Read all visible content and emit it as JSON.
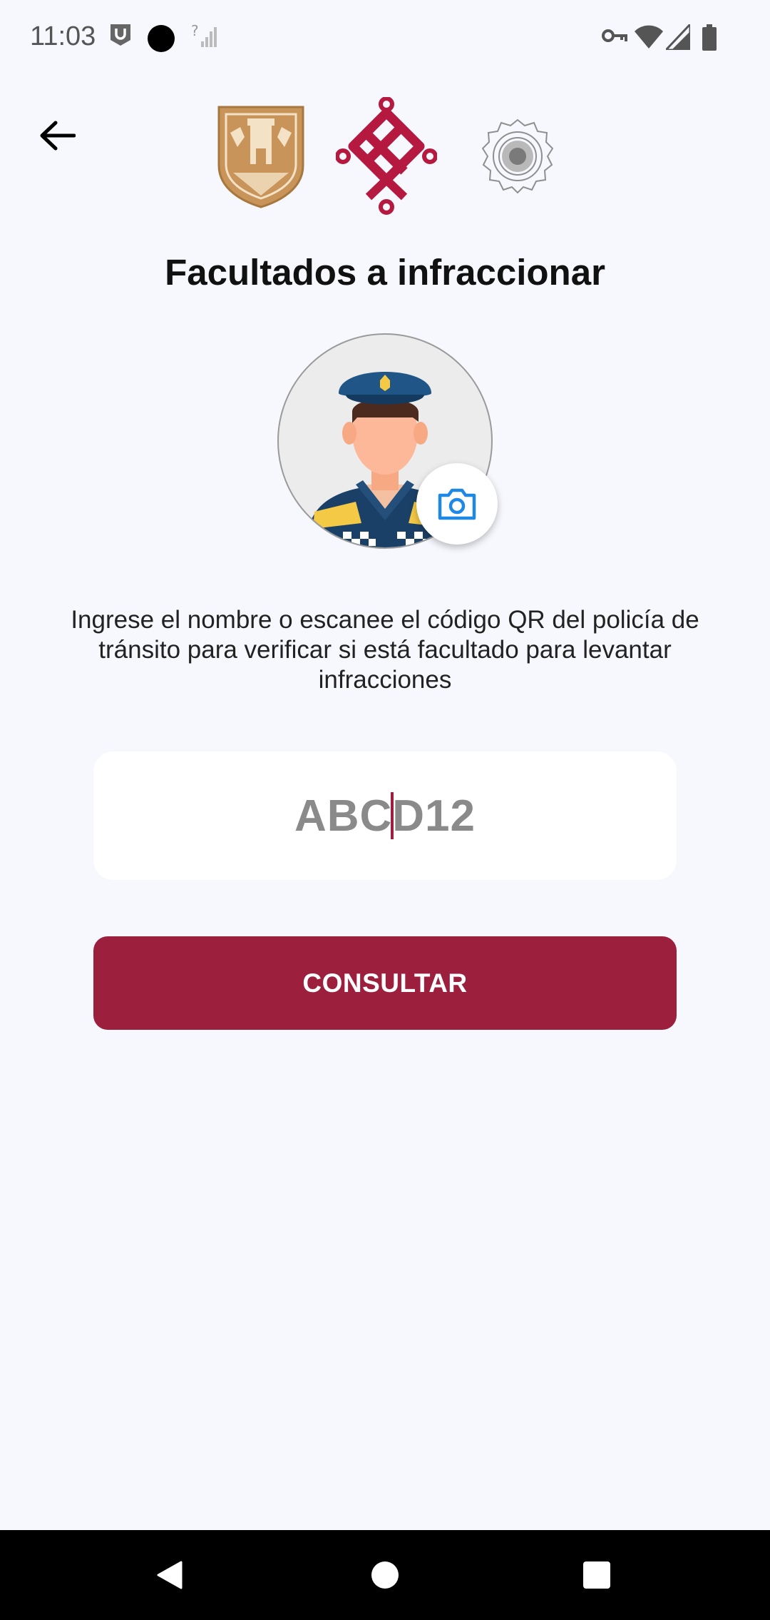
{
  "status_bar": {
    "time": "11:03",
    "left_icons": [
      "notification-icon",
      "dot-icon",
      "no-signal-icon"
    ],
    "right_icons": [
      "vpn-key-icon",
      "wifi-icon",
      "signal-icon",
      "battery-icon"
    ]
  },
  "header": {
    "back_icon": "arrow-left-icon",
    "logos": [
      "cdmx-shield-logo",
      "cdmx-emblem-logo",
      "police-badge-logo"
    ]
  },
  "page": {
    "title": "Facultados a infraccionar",
    "description": "Ingrese el nombre o escanee el código QR del policía de tránsito para verificar si está facultado para levantar infracciones"
  },
  "code_input": {
    "before_caret": "ABC",
    "after_caret": "D12"
  },
  "consult_button": {
    "label": "CONSULTAR"
  },
  "colors": {
    "brand": "#9d1f3e",
    "background": "#f7f8fd",
    "shield_gold": "#c8945a",
    "camera_blue": "#1e88e5"
  },
  "nav_bar": {
    "icons": [
      "back-triangle-icon",
      "home-circle-icon",
      "recents-square-icon"
    ]
  }
}
